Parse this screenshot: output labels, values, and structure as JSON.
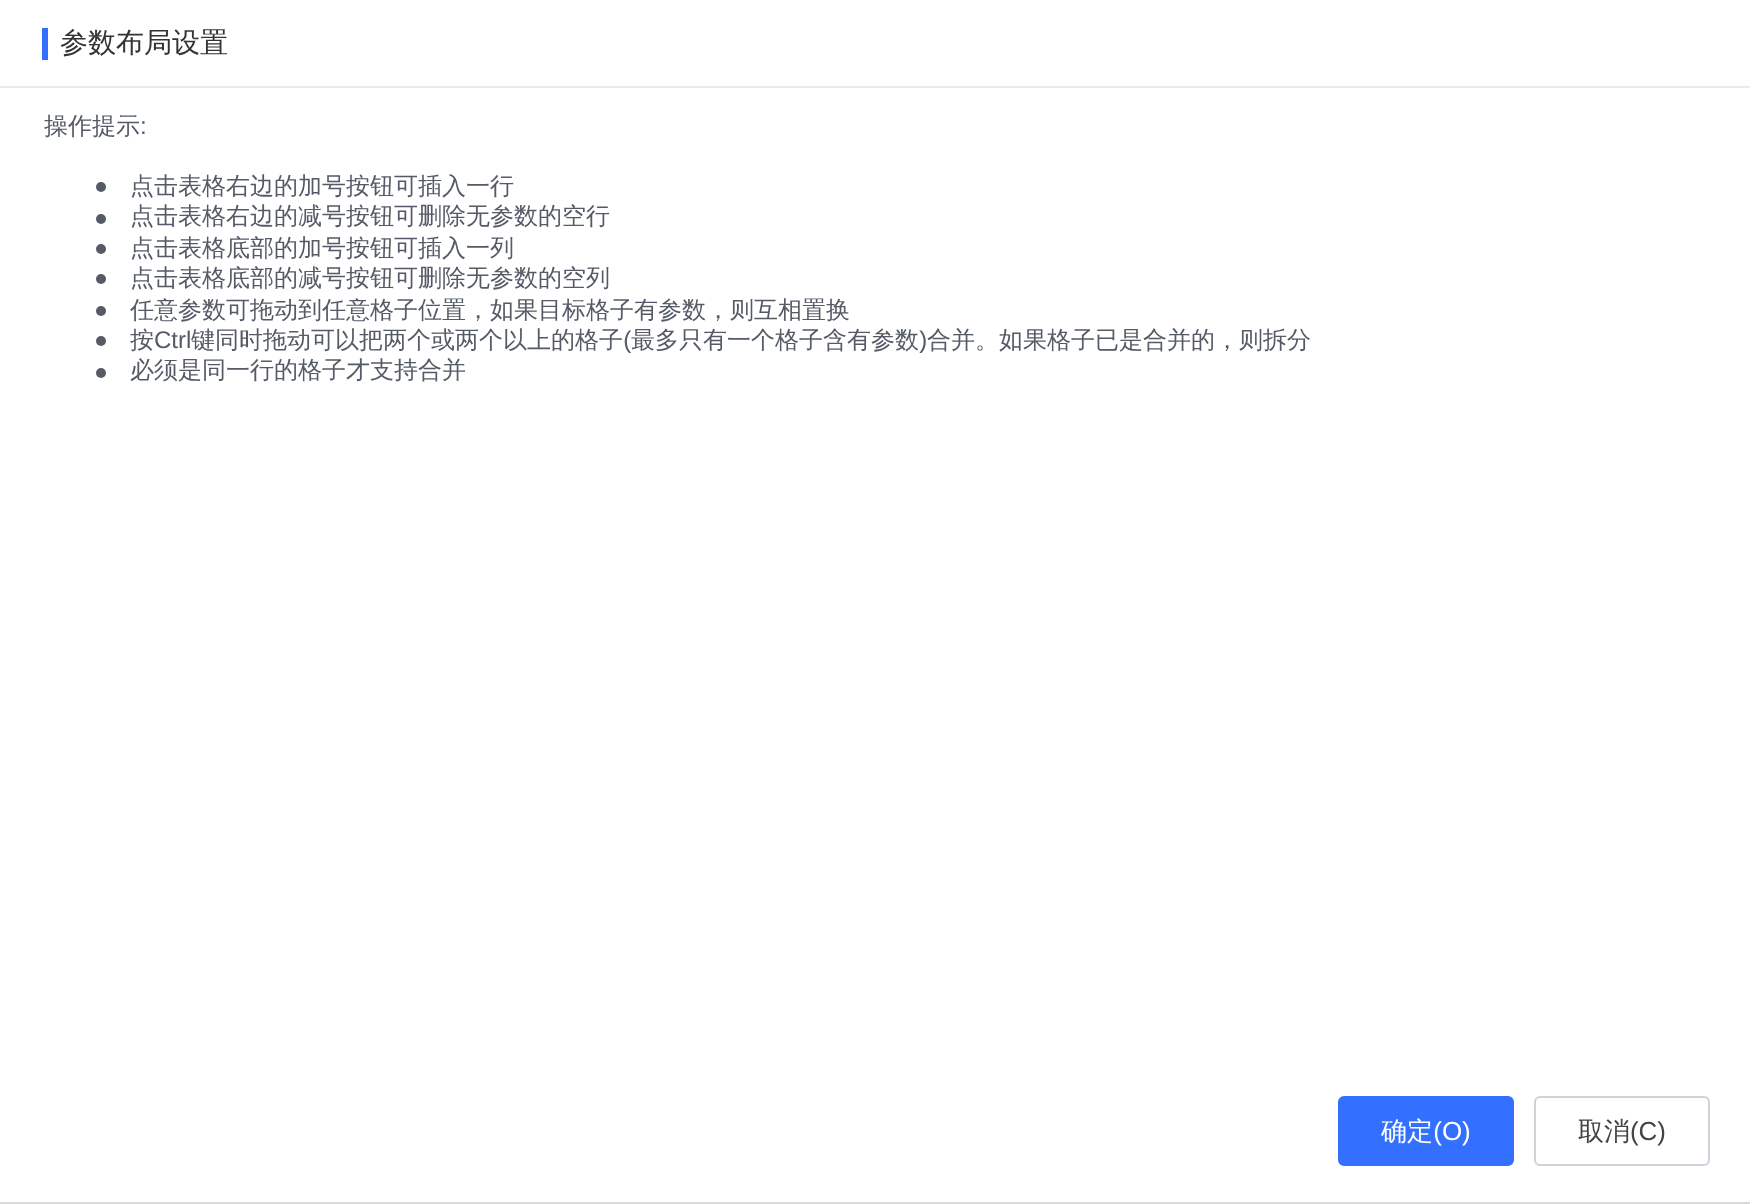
{
  "dialog": {
    "title": "参数布局设置"
  },
  "hint_heading": "操作提示:",
  "hints": [
    "点击表格右边的加号按钮可插入一行",
    "点击表格右边的减号按钮可删除无参数的空行",
    "点击表格底部的加号按钮可插入一列",
    "点击表格底部的减号按钮可删除无参数的空列",
    "任意参数可拖动到任意格子位置，如果目标格子有参数，则互相置换",
    "按Ctrl键同时拖动可以把两个或两个以上的格子(最多只有一个格子含有参数)合并。如果格子已是合并的，则拆分",
    "必须是同一行的格子才支持合并"
  ],
  "buttons": [
    {
      "label": "确定(O)",
      "kind": "primary"
    },
    {
      "label": "取消(C)",
      "kind": "secondary"
    }
  ]
}
